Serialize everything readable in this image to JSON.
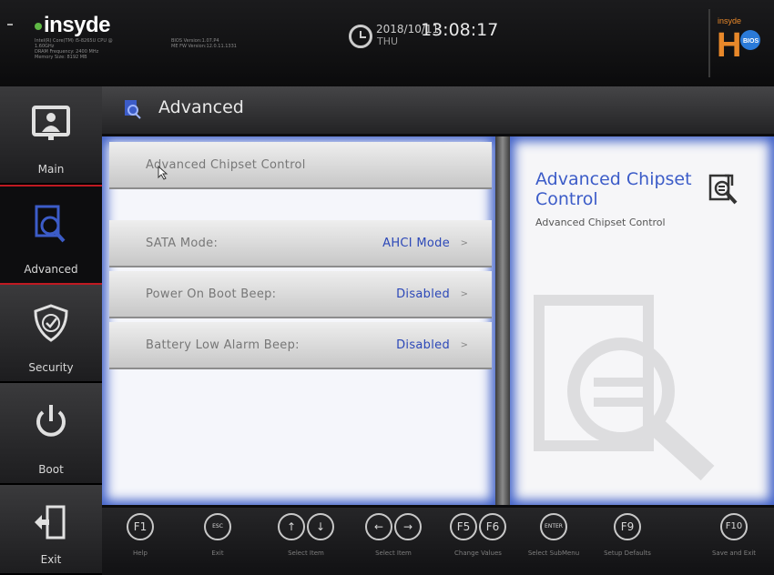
{
  "header": {
    "brand": "insyde",
    "system_info_left": [
      "Intel(R) Core(TM) i5-8265U CPU @",
      "1.60GHz",
      "DRAM Frequency: 2400 MHz",
      "Memory Size: 8192 MB"
    ],
    "system_info_right": [
      "BIOS Version:1.07.P4",
      "ME FW Version:12.0.11.1331"
    ],
    "date": "2018/10/11",
    "weekday": "THU",
    "time": "13:08:17",
    "bios_logo_text": "BIOS"
  },
  "sidebar": {
    "items": [
      {
        "label": "Main",
        "icon": "monitor-user-icon"
      },
      {
        "label": "Advanced",
        "icon": "document-search-icon"
      },
      {
        "label": "Security",
        "icon": "shield-check-icon"
      },
      {
        "label": "Boot",
        "icon": "power-icon"
      },
      {
        "label": "Exit",
        "icon": "exit-door-icon"
      }
    ],
    "active_index": 1
  },
  "page": {
    "title": "Advanced"
  },
  "menu": {
    "submenu_label": "Advanced Chipset Control",
    "settings": [
      {
        "label": "SATA Mode:",
        "value": "AHCI Mode"
      },
      {
        "label": "Power On Boot Beep:",
        "value": "Disabled"
      },
      {
        "label": "Battery Low Alarm Beep:",
        "value": "Disabled"
      }
    ],
    "arrow": ">"
  },
  "help": {
    "title": "Advanced Chipset Control",
    "text": "Advanced Chipset Control"
  },
  "footer": {
    "keys": [
      {
        "icons": [
          "F1"
        ],
        "label": "Help"
      },
      {
        "icons": [
          "ESC"
        ],
        "label": "Exit"
      },
      {
        "icons": [
          "↑",
          "↓"
        ],
        "label": "Select Item"
      },
      {
        "icons": [
          "←",
          "→"
        ],
        "label": "Select Item"
      },
      {
        "icons": [
          "F5",
          "F6"
        ],
        "label": "Change Values"
      },
      {
        "icons": [
          "ENTER"
        ],
        "label": "Select SubMenu"
      },
      {
        "icons": [
          "F9"
        ],
        "label": "Setup Defaults"
      },
      {
        "icons": [
          "F10"
        ],
        "label": "Save and Exit"
      }
    ]
  },
  "colors": {
    "accent": "#3c5cc8",
    "active_tab_border": "#c01a22",
    "panel_glow": "#3f60c8"
  }
}
